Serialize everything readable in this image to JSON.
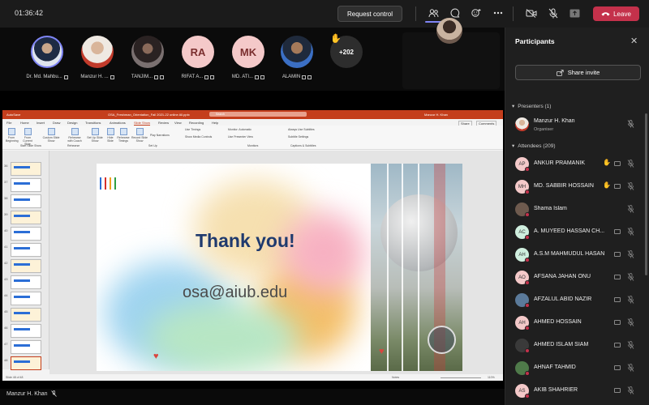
{
  "topbar": {
    "timer": "01:36:42",
    "request_control": "Request control",
    "leave": "Leave"
  },
  "strip": {
    "participants": [
      {
        "name": "Dr. Md. Mahbu...",
        "initials": "",
        "color": "#2e4a7a"
      },
      {
        "name": "Manzur H. ...",
        "initials": "",
        "color": "#b39b86"
      },
      {
        "name": "TANJIM...",
        "initials": "",
        "color": "#4a3a3a"
      },
      {
        "name": "RIFAT A...",
        "initials": "RA",
        "color": "#f4c9c9"
      },
      {
        "name": "MD. ATI...",
        "initials": "MK",
        "color": "#f4c9c9"
      },
      {
        "name": "ALAMIN",
        "initials": "",
        "color": "#3b5b8a"
      }
    ],
    "overflow": "+202"
  },
  "powerpoint": {
    "autosave": "AutoSave",
    "filename": "OSA_Freshman_Orientation_Fall 2021-22 online All.pptx",
    "search": "Search",
    "user": "Manzur H. Khan",
    "tabs": [
      "File",
      "Home",
      "Insert",
      "Draw",
      "Design",
      "Transitions",
      "Animations",
      "Slide Show",
      "Review",
      "View",
      "Recording",
      "Help"
    ],
    "share": "Share",
    "comments": "Comments",
    "ribbon": [
      "From Beginning",
      "From Current Slide",
      "Custom Slide Show",
      "Rehearse with Coach",
      "Set Up Slide Show",
      "Hide Slide",
      "Rehearse Timings",
      "Record Slide Show"
    ],
    "ribbon_opts": [
      "Play Narrations",
      "Use Timings",
      "Show Media Controls",
      "Monitor: Automatic",
      "Use Presenter View",
      "Always Use Subtitles",
      "Subtitle Settings"
    ],
    "groups": [
      "Start Slide Show",
      "Rehearse",
      "Set Up",
      "Monitors",
      "Captions & Subtitles"
    ],
    "thumb_nums": [
      "36",
      "37",
      "38",
      "39",
      "40",
      "41",
      "42",
      "43",
      "44",
      "45",
      "46",
      "47",
      "48"
    ],
    "status_left": "Slide 48 of 48",
    "status_right": "Notes",
    "zoom": "110%"
  },
  "slide": {
    "title": "Thank you!",
    "email": "osa@aiub.edu",
    "bar_colors": [
      "#2b6ed6",
      "#d6302b",
      "#f0a21e",
      "#2f9e44"
    ]
  },
  "presenter_label": "Manzur H. Khan",
  "panel": {
    "title": "Participants",
    "share_invite": "Share invite",
    "presenters_label": "Presenters (1)",
    "presenter": {
      "name": "Manzur H. Khan",
      "role": "Organiser"
    },
    "attendees_label": "Attendees (209)",
    "attendees": [
      {
        "initials": "AP",
        "name": "ANKUR PRAMANIK",
        "hand": true,
        "color": "#f4c9c9"
      },
      {
        "initials": "MH",
        "name": "MD. SABBIR HOSSAIN",
        "hand": true,
        "color": "#f4c9c9"
      },
      {
        "initials": "",
        "name": "Shama Islam",
        "hand": false,
        "color": "#6e5a4e"
      },
      {
        "initials": "AC",
        "name": "A. MUYEED HASSAN CH...",
        "hand": false,
        "color": "#cfeede"
      },
      {
        "initials": "AH",
        "name": "A.S.M MAHMUDUL HASAN",
        "hand": false,
        "color": "#cfeede"
      },
      {
        "initials": "AO",
        "name": "AFSANA JAHAN ONU",
        "hand": false,
        "color": "#f4c9c9"
      },
      {
        "initials": "",
        "name": "AFZALUL ABID NAZIR",
        "hand": false,
        "color": "#5b7a9a"
      },
      {
        "initials": "AH",
        "name": "AHMED HOSSAIN",
        "hand": false,
        "color": "#f4c9c9"
      },
      {
        "initials": "",
        "name": "AHMED ISLAM SIAM",
        "hand": false,
        "color": "#3a3a3a"
      },
      {
        "initials": "",
        "name": "AHNAF TAHMID",
        "hand": false,
        "color": "#4f7a4a"
      },
      {
        "initials": "AS",
        "name": "AKIB SHAHRIER",
        "hand": false,
        "color": "#f4c9c9"
      }
    ]
  }
}
